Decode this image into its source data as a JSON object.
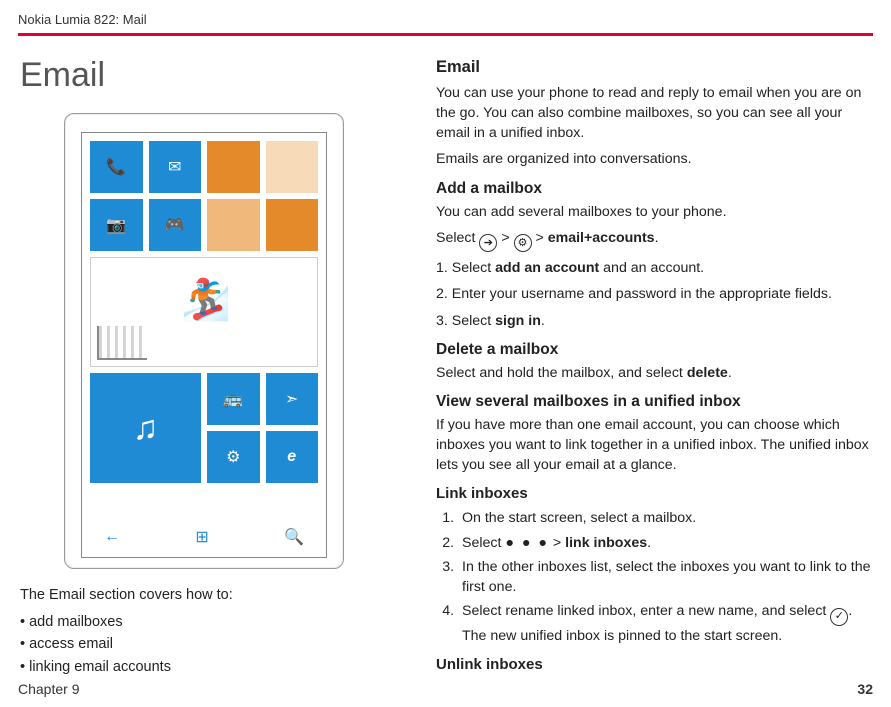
{
  "header": {
    "breadcrumb": "Nokia Lumia 822: Mail"
  },
  "left": {
    "title": "Email",
    "covers_intro": "The Email section covers how to:",
    "bullets": [
      "add mailboxes",
      "access email",
      "linking email accounts"
    ]
  },
  "right": {
    "h_email": "Email",
    "p_intro": "You can use your phone to read and reply to email when you are on the go. You can also combine mailboxes, so you can see all your email in a unified inbox.",
    "p_conv": "Emails are organized into conversations.",
    "h_add": "Add a mailbox",
    "p_add_intro": "You can add several mailboxes to your phone.",
    "select_word": "Select ",
    "gt": " > ",
    "email_accounts": "email+accounts",
    "period": ".",
    "step1a": "1. Select ",
    "step1b": "add an account",
    "step1c": " and an account.",
    "step2": "2. Enter your username and password in the appropriate fields.",
    "step3a": "3. Select ",
    "step3b": "sign in",
    "h_delete": "Delete a mailbox",
    "p_delete_a": "Select and hold the mailbox, and select ",
    "p_delete_b": "delete",
    "h_view": "View several mailboxes in a unified inbox",
    "p_view": "If you have more than one email account, you can choose which inboxes you want to link together in a unified inbox. The unified inbox lets you see all your email at a glance.",
    "h_link": "Link inboxes",
    "ol": {
      "i1": "On the start screen, select a mailbox.",
      "i2a": "Select ",
      "i2_dots": "● ● ●",
      "i2b": "link inboxes",
      "i3": "In the other inboxes list, select the inboxes you want to link to the first one.",
      "i4a": "Select rename linked inbox, enter a new name, and select ",
      "i4b": ". The new unified inbox is pinned to the start screen."
    },
    "h_unlink": "Unlink inboxes"
  },
  "footer": {
    "chapter": "Chapter 9",
    "page": "32"
  },
  "icons": {
    "arrow_right": "➔",
    "gear": "⚙",
    "check": "✓",
    "phone": "📞",
    "mail": "✉",
    "camera": "📷",
    "game": "🎮",
    "music": "♫",
    "bus": "🚌",
    "compass": "➣",
    "settings": "⚙",
    "ie": "e",
    "back": "←",
    "win": "⊞",
    "search": "🔍"
  }
}
